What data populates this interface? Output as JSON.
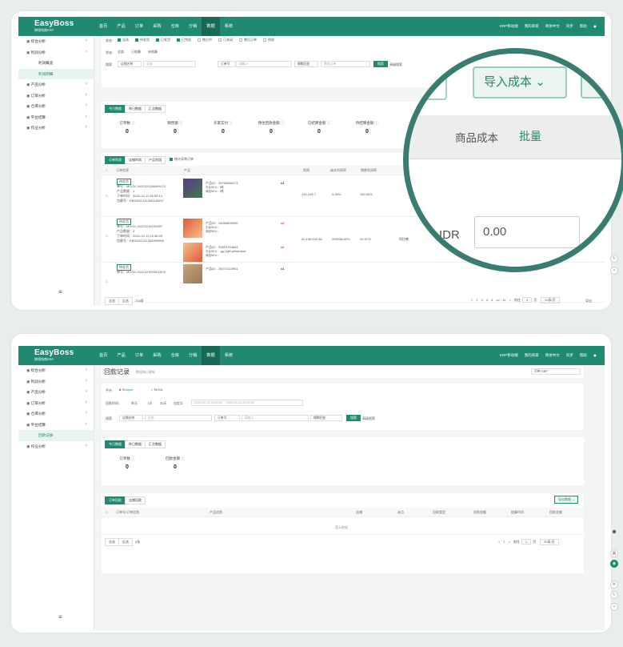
{
  "app": {
    "logo": "EasyBoss",
    "logo_sub": "跨境电商ERP"
  },
  "nav": [
    "首页",
    "产品",
    "订单",
    "采购",
    "仓库",
    "分销",
    "数据",
    "系统"
  ],
  "nav_active": 6,
  "header_right": [
    "ERP移动端",
    "我的商家",
    "简体中文",
    "同步",
    "帮助"
  ],
  "sidebar1": [
    {
      "label": "综合分析",
      "exp": true
    },
    {
      "label": "利润分析",
      "exp": true,
      "open": true
    },
    {
      "label": "利润概览",
      "sub": true
    },
    {
      "label": "利润明细",
      "sub": true,
      "active": true
    },
    {
      "label": "产品分析",
      "exp": true
    },
    {
      "label": "订单分析",
      "exp": true
    },
    {
      "label": "仓库分析",
      "exp": true
    },
    {
      "label": "平台结算",
      "exp": true
    },
    {
      "label": "作业分析",
      "exp": true
    }
  ],
  "sidebar2": [
    {
      "label": "综合分析",
      "exp": true
    },
    {
      "label": "利润分析",
      "exp": true
    },
    {
      "label": "产品分析",
      "exp": true
    },
    {
      "label": "订单分析",
      "exp": true
    },
    {
      "label": "仓库分析",
      "exp": true
    },
    {
      "label": "平台结算",
      "exp": true,
      "open": true
    },
    {
      "label": "回款记录",
      "sub": true,
      "active": true
    },
    {
      "label": "作业分析",
      "exp": true
    }
  ],
  "s1": {
    "status_label": "状态:",
    "status_opts": [
      "全选",
      "待发货",
      "已发货",
      "已完成",
      "售后中",
      "已关闭",
      "售后订单",
      "揽收"
    ],
    "status2_label": "状态:",
    "status2_opts": [
      "全部",
      "已结算",
      "未结算"
    ],
    "search_label": "搜索:",
    "shop_sel": "店铺名称",
    "all_sel": "全部",
    "order_sel": "订单号",
    "input_ph": "请输入",
    "fuzzy": "模糊匹配",
    "order_ph": "筛选订单",
    "search_btn": "搜索",
    "adv": "高级搜索",
    "period_tabs": [
      "今日数据",
      "昨日数据",
      "汇总数据"
    ],
    "stats": [
      {
        "label": "订单数",
        "value": "0"
      },
      {
        "label": "销售额",
        "value": "0"
      },
      {
        "label": "买家实付",
        "value": "0"
      },
      {
        "label": "预估回款金额",
        "value": "0"
      },
      {
        "label": "已结算金额",
        "value": "0"
      },
      {
        "label": "待结算金额",
        "value": "0"
      }
    ],
    "table_tabs": [
      "订单利润",
      "店铺利润",
      "产品利润"
    ],
    "show_abnormal": "统计异常订单",
    "cols": [
      "订单信息",
      "产品",
      "利润",
      "成本利润率",
      "销售利润率"
    ],
    "rows": [
      {
        "tag": "待发货",
        "order_no": "单号：MOCK-2412110Q4A6HLCZ",
        "qty": "产品数量：1",
        "time": "下单时间：2024-12-11 06:00:14",
        "pkg": "包裹号：EB20241211405140037",
        "items": [
          {
            "id": "产品ID：29758486373",
            "l1": "平台SKU：5件",
            "l2": "商品SKU：5件",
            "mult": "x1"
          }
        ],
        "profit": "132,128.7",
        "cpr": "0.06%",
        "spr": "100.00%"
      },
      {
        "tag": "待发货",
        "order_no": "单号：MOCK-2412110U10V007",
        "qty": "产品数量：4",
        "time": "下单时间：2024-12-11 03:49:28",
        "pkg": "包裹号：EB20241211354399966",
        "items": [
          {
            "id": "产品ID：25084809050",
            "l1": "平台SKU：",
            "l2": "商品SKU：",
            "mult": "x2"
          },
          {
            "id": "产品ID：29519754843",
            "l1": "平台SKU：-gg-Light yellow-qww",
            "l2": "商品SKU：",
            "mult": "x2"
          }
        ],
        "profit": "42,106,542.38",
        "cpr": "299238.60%",
        "spr": "99.97%",
        "extra": "阿拉善"
      },
      {
        "tag": "待发货",
        "order_no": "单号：MOCK-2412110DYBDQEXI",
        "qty": "",
        "time": "",
        "pkg": "",
        "items": [
          {
            "id": "产品ID：25074122951",
            "l1": "",
            "l2": "",
            "mult": "x1"
          }
        ],
        "profit": "",
        "cpr": "",
        "spr": ""
      }
    ],
    "footer": {
      "all": "全选",
      "inv": "反选",
      "count": "216条"
    },
    "pager": [
      "<",
      "1",
      "2",
      "3",
      "4",
      "•••",
      "11",
      ">"
    ],
    "jump": "前往",
    "page": "1",
    "page_unit": "页",
    "per": "20条/页",
    "export": "导出"
  },
  "zoom": {
    "btn": "导入成本",
    "col": "商品成本",
    "batch": "批量",
    "cur": "IDR",
    "val": "0.00"
  },
  "s2": {
    "title": "回款记录",
    "title_sub": "数据每日更新",
    "currency": "币种 GBP",
    "platform_label": "平台:",
    "platforms": [
      "Shopee",
      "TikTok"
    ],
    "time_label": "回款时间:",
    "time_opts": [
      "昨天",
      "7天",
      "30天",
      "自定义"
    ],
    "date_start": "2025-06-23 00:00:00",
    "date_end": "2025-06-24 00:00:00",
    "search_label": "搜索:",
    "shop_sel": "店铺名称",
    "all_sel": "全部",
    "order_sel": "订单号",
    "input_ph": "请输入",
    "fuzzy": "模糊匹配",
    "search_btn": "搜索",
    "adv": "高级搜索",
    "period_tabs": [
      "今日数据",
      "昨日数据",
      "汇总数据"
    ],
    "stats": [
      {
        "label": "订单数",
        "value": "0"
      },
      {
        "label": "回款金额",
        "value": "0"
      }
    ],
    "table_tabs": [
      "订单回款",
      "店铺回款"
    ],
    "export": "导出数据",
    "cols": [
      "订单号/订单信息",
      "产品信息",
      "店铺",
      "站点",
      "回款类型",
      "回款金额",
      "结算时间",
      "回款金额"
    ],
    "empty": "暂无数据",
    "footer": {
      "all": "全选",
      "inv": "反选",
      "count": "0条"
    },
    "pager": [
      "<",
      "1",
      ">"
    ],
    "jump": "前往",
    "page": "1",
    "page_unit": "页",
    "per": "20条/页"
  },
  "colors": {
    "brand": "#1f8a70",
    "ring": "#3a7b73",
    "warn": "#d9362b"
  }
}
